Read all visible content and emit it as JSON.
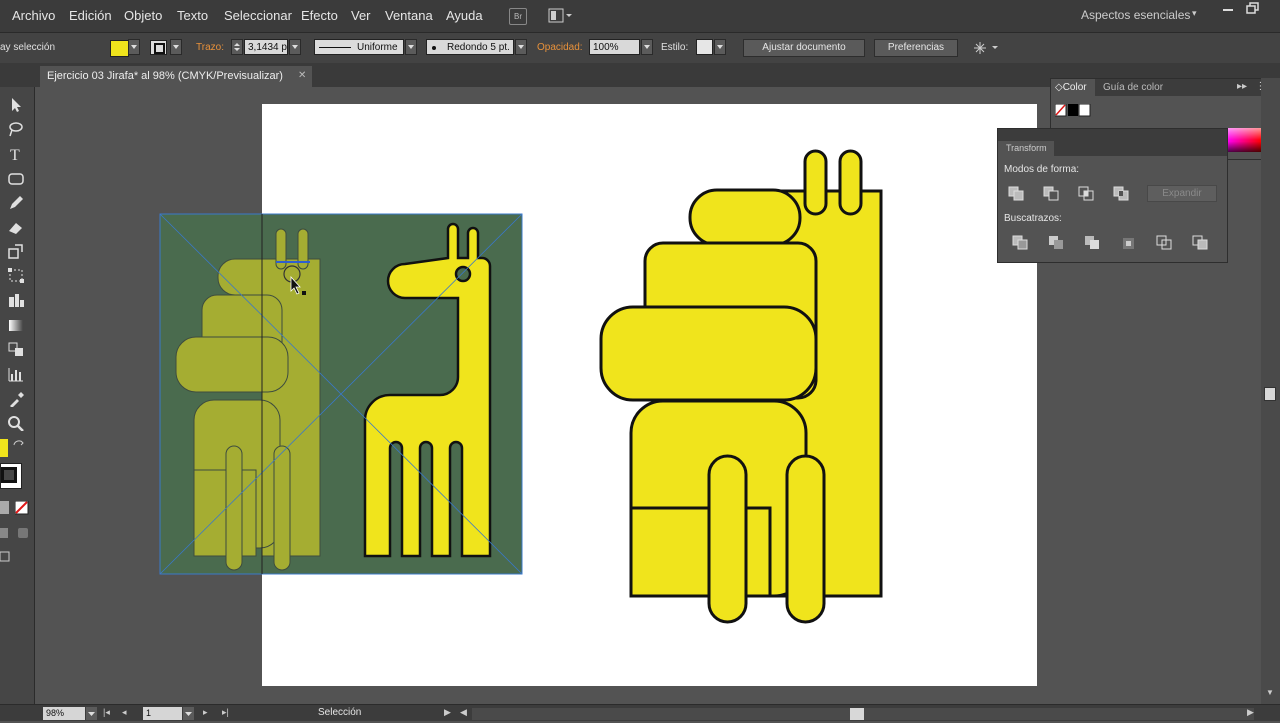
{
  "menubar": {
    "items": [
      "Archivo",
      "Edición",
      "Objeto",
      "Texto",
      "Seleccionar",
      "Efecto",
      "Ver",
      "Ventana",
      "Ayuda"
    ],
    "bridge_label": "Br",
    "workspace": "Aspectos esenciales"
  },
  "controlbar": {
    "selection_label": "ay selección",
    "fill_color": "#f0e41c",
    "stroke_label": "Trazo:",
    "stroke_weight": "3,1434 p",
    "stroke_profile": "Uniforme",
    "brush": "Redondo 5 pt.",
    "opacity_label": "Opacidad:",
    "opacity_value": "100%",
    "style_label": "Estilo:",
    "document_button": "Ajustar documento",
    "preferences_button": "Preferencias"
  },
  "document": {
    "tab_title": "Ejercicio 03 Jirafa* al 98% (CMYK/Previsualizar)",
    "close_glyph": "✕"
  },
  "color_panel": {
    "tab_color": "Color",
    "tab_guide": "Guía de color"
  },
  "transform_panel": {
    "tab": "Transform",
    "shape_modes": "Modos de forma:",
    "expand": "Expandir",
    "pathfinders": "Buscatrazos:"
  },
  "statusbar": {
    "zoom": "98%",
    "artboard": "1",
    "tool": "Selección"
  },
  "colors": {
    "giraffe_yellow": "#f0e41c",
    "template_green": "#4a6b4e",
    "selection_blue": "#3a78c9"
  }
}
